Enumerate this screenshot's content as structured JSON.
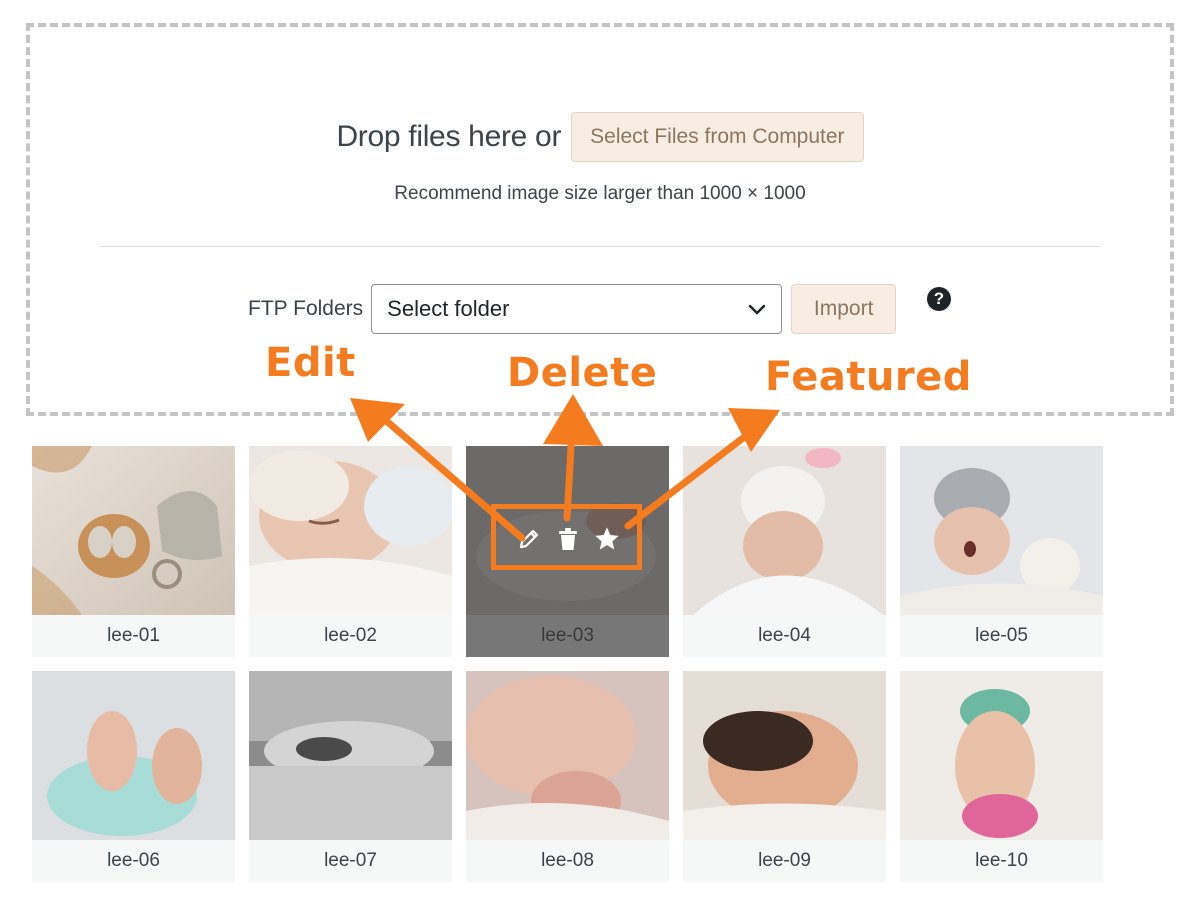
{
  "dropzone": {
    "drop_text": "Drop files here or",
    "select_files_label": "Select Files from Computer",
    "recommend_text": "Recommend image size larger than 1000 × 1000"
  },
  "ftp": {
    "label": "FTP Folders",
    "select_value": "Select folder",
    "import_label": "Import",
    "help_glyph": "?"
  },
  "annotations": {
    "edit": "Edit",
    "delete": "Delete",
    "featured": "Featured"
  },
  "colors": {
    "accent_orange": "#f47b1e",
    "button_bg": "#f8ede2",
    "button_text": "#8c7660"
  },
  "gallery": {
    "items": [
      {
        "label": "lee-01"
      },
      {
        "label": "lee-02"
      },
      {
        "label": "lee-03"
      },
      {
        "label": "lee-04"
      },
      {
        "label": "lee-05"
      },
      {
        "label": "lee-06"
      },
      {
        "label": "lee-07"
      },
      {
        "label": "lee-08"
      },
      {
        "label": "lee-09"
      },
      {
        "label": "lee-10"
      }
    ],
    "hovered_item": "lee-03",
    "hover_actions": [
      "pencil-icon",
      "trash-icon",
      "star-icon"
    ]
  }
}
